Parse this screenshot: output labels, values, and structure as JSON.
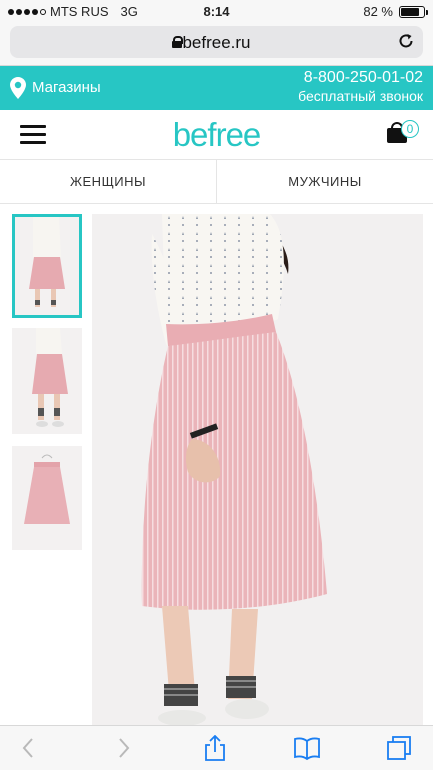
{
  "status": {
    "carrier": "MTS RUS",
    "network": "3G",
    "time": "8:14",
    "battery": "82 %",
    "battery_level": 0.82
  },
  "browser": {
    "domain": "befree.ru"
  },
  "storebar": {
    "stores_label": "Магазины",
    "phone": "8-800-250-01-02",
    "phone_note": "бесплатный звонок",
    "color": "#27c6c4"
  },
  "header": {
    "logo": "befree",
    "cart_count": "0"
  },
  "tabs": [
    {
      "label": "ЖЕНЩИНЫ"
    },
    {
      "label": "МУЖЧИНЫ"
    }
  ],
  "icons": {
    "back": "chevron-left-icon",
    "forward": "chevron-right-icon",
    "share": "share-icon",
    "bookmarks": "bookmarks-icon",
    "tabs": "tabs-icon"
  }
}
